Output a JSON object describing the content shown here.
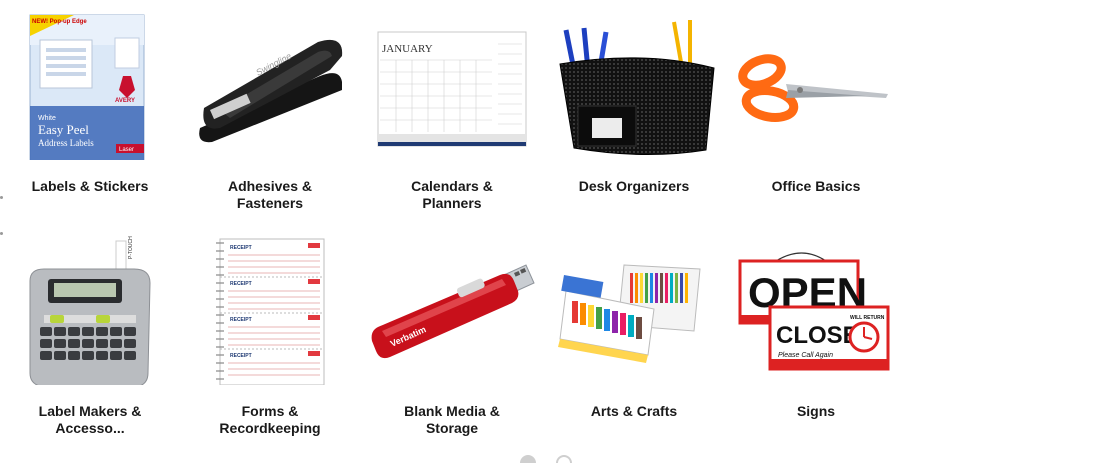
{
  "categories": [
    {
      "label": "Labels & Stickers",
      "icon": "address-labels-box"
    },
    {
      "label": "Adhesives & Fasteners",
      "icon": "stapler"
    },
    {
      "label": "Calendars & Planners",
      "icon": "desk-calendar"
    },
    {
      "label": "Desk Organizers",
      "icon": "mesh-desk-organizer"
    },
    {
      "label": "Office Basics",
      "icon": "scissors"
    },
    {
      "label": "Label Makers & Accesso...",
      "icon": "label-maker"
    },
    {
      "label": "Forms & Recordkeeping",
      "icon": "receipt-book"
    },
    {
      "label": "Blank Media & Storage",
      "icon": "usb-flash-drive"
    },
    {
      "label": "Arts & Crafts",
      "icon": "art-kit"
    },
    {
      "label": "Signs",
      "icon": "open-closed-sign"
    }
  ],
  "images": {
    "labels_box": {
      "brand_badge": "NEW! Pop-up Edge",
      "brand": "AVERY",
      "title1": "White",
      "title2": "Easy Peel",
      "title3": "Address Labels",
      "tag": "Laser"
    },
    "stapler_brand": "Swingline",
    "calendar": {
      "month": "JANUARY"
    },
    "label_maker_brand": "P-TOUCH",
    "receipt_title": "RECEIPT",
    "usb_brand": "Verbatim",
    "sign": {
      "open": "OPEN",
      "closed": "CLOSED",
      "will_return": "WILL RETURN",
      "call_again": "Please Call Again"
    }
  },
  "carousel": {
    "pages": 2,
    "active": 1
  }
}
